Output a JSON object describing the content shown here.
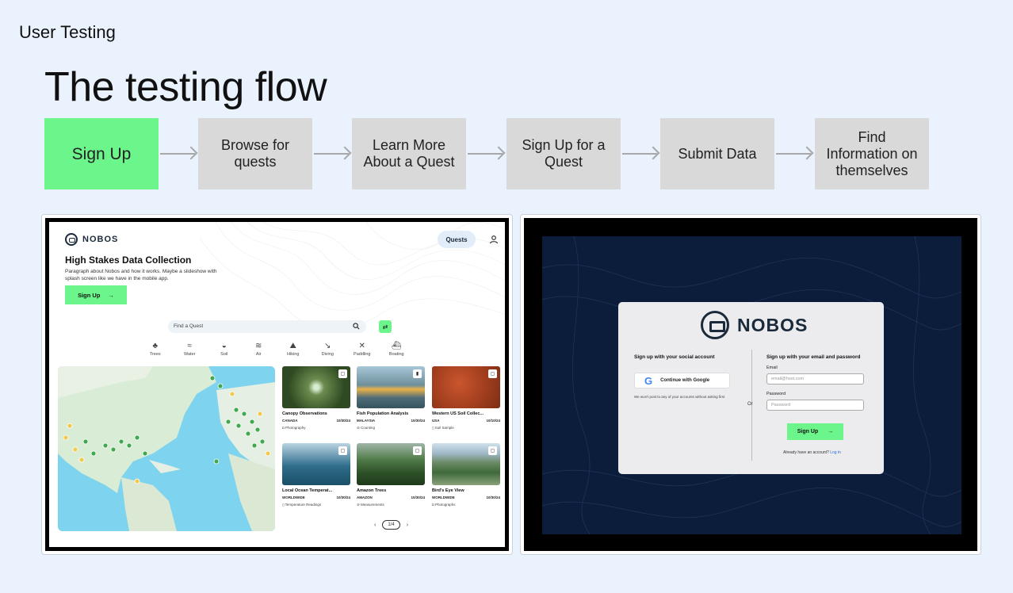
{
  "slide": {
    "label": "User Testing",
    "title": "The testing flow"
  },
  "flow": {
    "steps": [
      {
        "label": "Sign Up",
        "active": true
      },
      {
        "label": "Browse for quests",
        "active": false
      },
      {
        "label": "Learn More About a Quest",
        "active": false
      },
      {
        "label": "Sign Up for a Quest",
        "active": false
      },
      {
        "label": "Submit Data",
        "active": false
      },
      {
        "label": "Find Information on themselves",
        "active": false
      }
    ],
    "active_color": "#6cf58a",
    "inactive_color": "#d9d9d9"
  },
  "home_screen": {
    "logo_text": "NOBOS",
    "nav_quests": "Quests",
    "hero_title": "High Stakes Data Collection",
    "hero_text": "Paragraph about Nobos and how it works. Maybe a slideshow with splash screen like we have in the mobile app.",
    "signup_label": "Sign Up",
    "search_placeholder": "Find a Quest",
    "categories": [
      "Trees",
      "Water",
      "Soil",
      "Air",
      "Hiking",
      "Diving",
      "Paddling",
      "Boating"
    ],
    "cards": [
      {
        "title": "Canopy Observations",
        "region": "CANADA",
        "date": "10/30/24",
        "tag": "Photography"
      },
      {
        "title": "Fish Population Analysis",
        "region": "MALAYSIA",
        "date": "10/30/24",
        "tag": "Counting"
      },
      {
        "title": "Western US Soil Collec...",
        "region": "USA",
        "date": "10/10/24",
        "tag": "Soil Sample"
      },
      {
        "title": "Local Ocean Temperat...",
        "region": "WORLDWIDE",
        "date": "10/30/24",
        "tag": "Temperature Readings"
      },
      {
        "title": "Amazon Trees",
        "region": "AMAZON",
        "date": "10/30/24",
        "tag": "Measurements"
      },
      {
        "title": "Bird's Eye View",
        "region": "WORLDWIDE",
        "date": "10/30/24",
        "tag": "Photographs"
      }
    ],
    "pager": "1/4"
  },
  "signup_screen": {
    "logo_text": "NOBOS",
    "social_title": "Sign up with your social account",
    "google_label": "Continue with Google",
    "social_note": "We won't post to any of your accounts without asking first",
    "or_label": "Or",
    "email_title": "Sign up with your email and password",
    "email_label": "Email",
    "email_placeholder": "email@host.com",
    "password_label": "Password",
    "password_placeholder": "Password",
    "signup_label": "Sign Up",
    "have_account": "Already have an account?",
    "login_link": "Log in"
  }
}
